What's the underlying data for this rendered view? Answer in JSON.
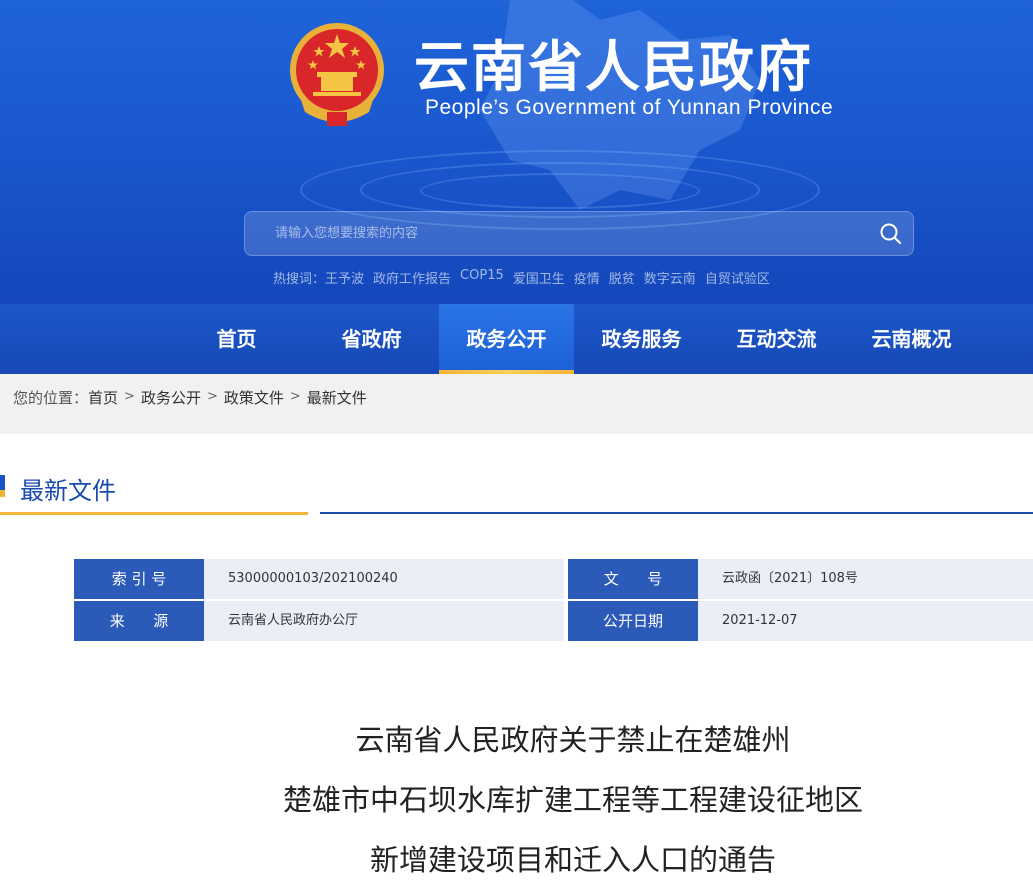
{
  "header": {
    "title": "云南省人民政府",
    "subtitle": "People’s Government of Yunnan Province",
    "search_placeholder": "请输入您想要搜索的内容",
    "hotwords_label": "热搜词：",
    "hotwords": [
      "王予波",
      "政府工作报告",
      "COP15",
      "爱国卫生",
      "疫情",
      "脱贫",
      "数字云南",
      "自贸试验区"
    ]
  },
  "nav": {
    "items": [
      {
        "label": "首页"
      },
      {
        "label": "省政府"
      },
      {
        "label": "政务公开",
        "active": true
      },
      {
        "label": "政务服务"
      },
      {
        "label": "互动交流"
      },
      {
        "label": "云南概况"
      }
    ]
  },
  "breadcrumb": {
    "prefix": "您的位置：",
    "items": [
      "首页",
      "政务公开",
      "政策文件",
      "最新文件"
    ],
    "separator": ">"
  },
  "section": {
    "title": "最新文件"
  },
  "info": {
    "index_label": "索 引 号",
    "index_value": "53000000103/202100240",
    "docno_label": "文      号",
    "docno_value": "云政函〔2021〕108号",
    "source_label": "来      源",
    "source_value": "云南省人民政府办公厅",
    "date_label": "公开日期",
    "date_value": "2021-12-07"
  },
  "document": {
    "title_lines": [
      "云南省人民政府关于禁止在楚雄州",
      "楚雄市中石坝水库扩建工程等工程建设征地区",
      "新增建设项目和迁入人口的通告"
    ]
  },
  "colors": {
    "header_blue": "#1f63d8",
    "nav_blue": "#1748b6",
    "accent_gold": "#f3b53c",
    "label_blue": "#2c5ab8",
    "value_bg": "#e9eef7"
  }
}
